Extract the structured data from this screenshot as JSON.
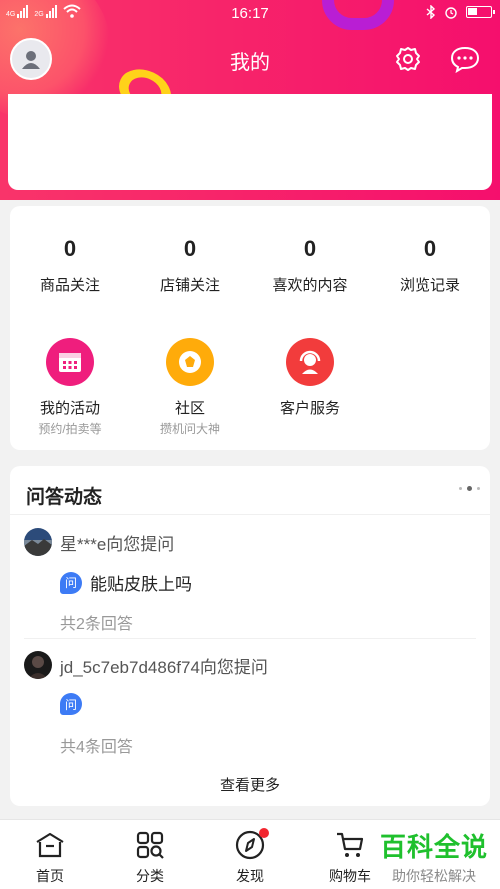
{
  "status_bar": {
    "time": "16:17",
    "net1": "4G",
    "net2": "2G"
  },
  "header": {
    "title": "我的"
  },
  "stats": [
    {
      "num": "0",
      "label": "商品关注"
    },
    {
      "num": "0",
      "label": "店铺关注"
    },
    {
      "num": "0",
      "label": "喜欢的内容"
    },
    {
      "num": "0",
      "label": "浏览记录"
    }
  ],
  "services": [
    {
      "name": "我的活动",
      "sub": "预约/拍卖等",
      "color": "#ef1e7d"
    },
    {
      "name": "社区",
      "sub": "攒机问大神",
      "color": "#ffab0a"
    },
    {
      "name": "客户服务",
      "sub": "",
      "color": "#f23c3c"
    }
  ],
  "qa": {
    "title": "问答动态",
    "items": [
      {
        "user": "星***e向您提问",
        "question": "能贴皮肤上吗",
        "badge": "问",
        "count": "共2条回答"
      },
      {
        "user": "jd_5c7eb7d486f74向您提问",
        "question": "",
        "badge": "问",
        "count": "共4条回答"
      }
    ],
    "more": "查看更多"
  },
  "nav": {
    "items": [
      {
        "label": "首页"
      },
      {
        "label": "分类"
      },
      {
        "label": "发现"
      },
      {
        "label": "购物车"
      }
    ]
  },
  "watermark": {
    "line1": "百科全说",
    "line2": "助你轻松解决"
  },
  "colors": {
    "header_red": "#f7246a",
    "accent_blue": "#3d7bf5",
    "badge_red": "#f2262f",
    "watermark_green": "#1fc02d"
  }
}
